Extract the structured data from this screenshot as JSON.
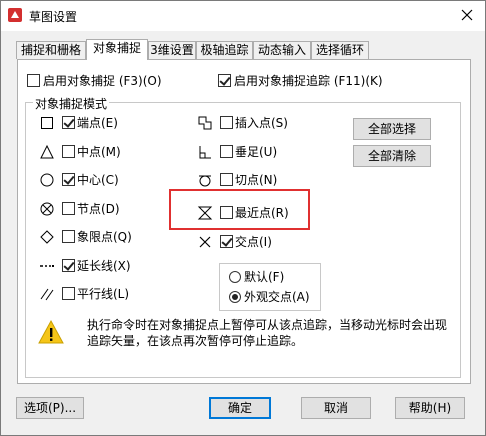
{
  "window": {
    "title": "草图设置"
  },
  "tabs": [
    {
      "label": "捕捉和栅格"
    },
    {
      "label": "对象捕捉"
    },
    {
      "label": "3维设置"
    },
    {
      "label": "极轴追踪"
    },
    {
      "label": "动态输入"
    },
    {
      "label": "选择循环"
    }
  ],
  "top_options": {
    "enable_snap": {
      "label": "启用对象捕捉 (F3)(O)",
      "checked": false
    },
    "enable_tracking": {
      "label": "启用对象捕捉追踪 (F11)(K)",
      "checked": true
    }
  },
  "group": {
    "title": "对象捕捉模式"
  },
  "snap_modes_left": [
    {
      "label": "端点(E)",
      "checked": true,
      "icon": "endpoint-icon"
    },
    {
      "label": "中点(M)",
      "checked": false,
      "icon": "midpoint-icon"
    },
    {
      "label": "中心(C)",
      "checked": true,
      "icon": "center-icon"
    },
    {
      "label": "节点(D)",
      "checked": false,
      "icon": "node-icon"
    },
    {
      "label": "象限点(Q)",
      "checked": false,
      "icon": "quadrant-icon"
    },
    {
      "label": "延长线(X)",
      "checked": true,
      "icon": "extension-icon"
    },
    {
      "label": "平行线(L)",
      "checked": false,
      "icon": "parallel-icon"
    }
  ],
  "snap_modes_right": [
    {
      "label": "插入点(S)",
      "checked": false,
      "icon": "insertion-icon"
    },
    {
      "label": "垂足(U)",
      "checked": false,
      "icon": "perpendicular-icon"
    },
    {
      "label": "切点(N)",
      "checked": false,
      "icon": "tangent-icon"
    },
    {
      "label": "最近点(R)",
      "checked": false,
      "icon": "nearest-icon"
    },
    {
      "label": "交点(I)",
      "checked": true,
      "icon": "intersection-icon"
    }
  ],
  "side_buttons": {
    "select_all": "全部选择",
    "clear_all": "全部清除"
  },
  "radio_options": [
    {
      "label": "默认(F)",
      "selected": false
    },
    {
      "label": "外观交点(A)",
      "selected": true
    }
  ],
  "info_text": "执行命令时在对象捕捉点上暂停可从该点追踪，当移动光标时会出现追踪矢量，在该点再次暂停可停止追踪。",
  "footer": {
    "options": "选项(P)...",
    "ok": "确定",
    "cancel": "取消",
    "help": "帮助(H)"
  }
}
